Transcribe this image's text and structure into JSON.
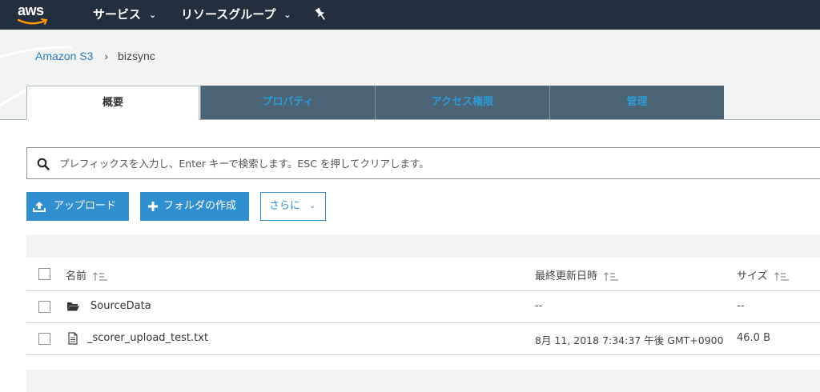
{
  "nav": {
    "logo": "aws",
    "services_label": "サービス",
    "resource_groups_label": "リソースグループ",
    "chevron": "⌄",
    "pin_icon": "pin-icon"
  },
  "breadcrumb": {
    "root": "Amazon S3",
    "separator": "›",
    "current": "bizsync"
  },
  "tabs": [
    {
      "label": "概要",
      "active": true
    },
    {
      "label": "プロパティ",
      "active": false
    },
    {
      "label": "アクセス権限",
      "active": false
    },
    {
      "label": "管理",
      "active": false
    }
  ],
  "search": {
    "placeholder": "プレフィックスを入力し、Enter キーで検索します。ESC を押してクリアします。",
    "value": ""
  },
  "actions": {
    "upload_label": "アップロード",
    "create_folder_label": "フォルダの作成",
    "more_label": "さらに",
    "more_chevron": "⌄"
  },
  "table": {
    "columns": [
      "名前",
      "最終更新日時",
      "サイズ"
    ],
    "rows": [
      {
        "type": "folder",
        "name": "SourceData",
        "modified": "--",
        "size": "--"
      },
      {
        "type": "file",
        "name": "_scorer_upload_test.txt",
        "modified": "8月 11, 2018 7:34:37 午後 GMT+0900",
        "size": "46.0 B"
      }
    ]
  },
  "colors": {
    "nav_bg": "#232f3e",
    "tab_inactive_bg": "#4a6375",
    "tab_inactive_text": "#2f9bd6",
    "primary": "#2f8fcf",
    "link": "#2b7ab8",
    "aws_orange": "#ff9900"
  }
}
